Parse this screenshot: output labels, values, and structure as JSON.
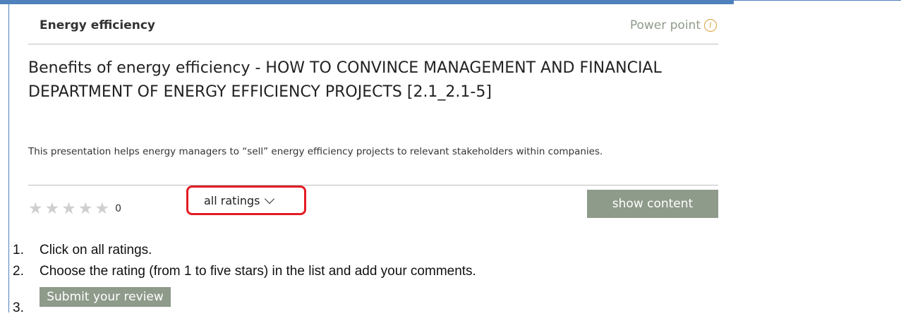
{
  "card": {
    "category": "Energy efficiency",
    "type_label": "Power point",
    "info_icon": "info-icon",
    "title": "Benefits of energy efficiency - HOW TO CONVINCE MANAGEMENT AND FINANCIAL DEPARTMENT OF ENERGY EFFICIENCY PROJECTS [2.1_2.1-5]",
    "description": "This presentation helps energy managers to “sell” energy efficiency projects to relevant stakeholders within companies.",
    "rating": {
      "stars_filled": 0,
      "stars_total": 5,
      "count": "0"
    },
    "ratings_dropdown_label": "all ratings",
    "show_content_label": "show content"
  },
  "instructions": [
    {
      "num": "1.",
      "text": "Click on all ratings."
    },
    {
      "num": "2.",
      "text": "Choose the rating (from 1 to five stars) in the list and add your comments."
    },
    {
      "num": "3.",
      "text": ""
    }
  ],
  "submit_label": "Submit your review",
  "colors": {
    "accent_blue": "#4f81bd",
    "button_gray_green": "#8e9a8a",
    "highlight_red": "#e31b23",
    "info_gold": "#d6a23a"
  }
}
